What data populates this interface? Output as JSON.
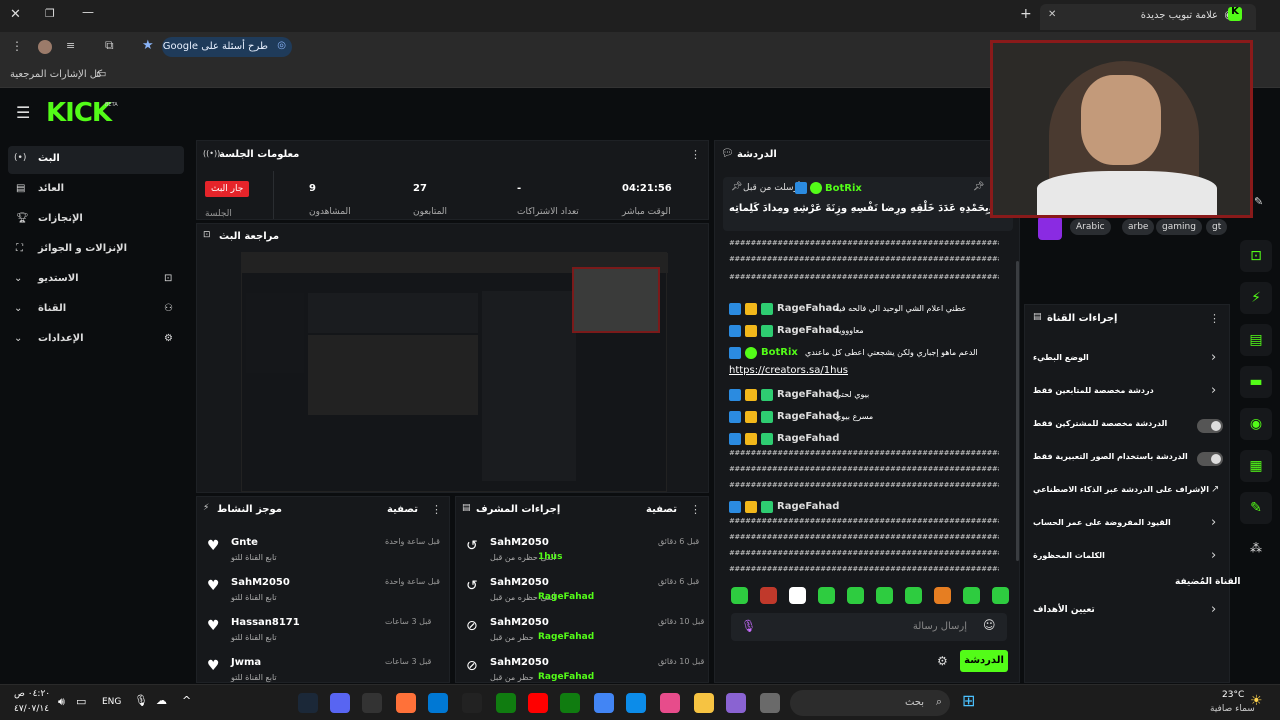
{
  "browser": {
    "tab_title": "علامة تبويب جديدة",
    "google_prompt": "طرح أسئلة على Google",
    "bookmarks_label": "كل الإشارات المرجعية"
  },
  "kick": {
    "logo": "KICK",
    "beta": "BETA"
  },
  "sidebar": {
    "items": [
      {
        "label": "البث",
        "icon": "broadcast-icon"
      },
      {
        "label": "العائد",
        "icon": "chart-icon"
      },
      {
        "label": "الإنجازات",
        "icon": "trophy-icon"
      },
      {
        "label": "الإنزالات و الجوائز",
        "icon": "gift-icon"
      },
      {
        "label": "الاستديو",
        "icon": "camera-icon"
      },
      {
        "label": "القناة",
        "icon": "users-icon"
      },
      {
        "label": "الإعدادات",
        "icon": "gear-icon"
      }
    ]
  },
  "session": {
    "title": "معلومات الجلسة",
    "live_badge": "جار البث",
    "session_label": "الجلسة",
    "stats": [
      {
        "value": "9",
        "label": "المشاهدون"
      },
      {
        "value": "27",
        "label": "المتابعون"
      },
      {
        "value": "-",
        "label": "تعداد الاشتراكات"
      },
      {
        "value": "04:21:56",
        "label": "الوقت مباشر"
      }
    ]
  },
  "preview": {
    "title": "مراجعة البث"
  },
  "activity": {
    "title": "موجز النشاط",
    "filter": "تصفية",
    "items": [
      {
        "name": "Gnte",
        "action": "تابع القناة للتو",
        "time": "قبل ساعة واحدة"
      },
      {
        "name": "SahM2050",
        "action": "تابع القناة للتو",
        "time": "قبل ساعة واحدة"
      },
      {
        "name": "Hassan8171",
        "action": "تابع القناة للتو",
        "time": "قبل 3 ساعات"
      },
      {
        "name": "Jwma",
        "action": "تابع القناة للتو",
        "time": "قبل 3 ساعات"
      }
    ]
  },
  "mod": {
    "title": "إجراءات المشرف",
    "filter": "تصفية",
    "items": [
      {
        "name": "SahM2050",
        "action": "ألغى حظره من قبل",
        "by": "1hus",
        "time": "قبل 6 دقائق"
      },
      {
        "name": "SahM2050",
        "action": "ألغى حظره من قبل",
        "by": "RageFahad",
        "time": "قبل 6 دقائق"
      },
      {
        "name": "SahM2050",
        "action": "حظر من قبل",
        "by": "RageFahad",
        "time": "قبل 10 دقائق"
      },
      {
        "name": "SahM2050",
        "action": "حظر من قبل",
        "by": "RageFahad",
        "time": "قبل 10 دقائق"
      }
    ]
  },
  "chat": {
    "title": "الدردشة",
    "pinned_by": "أرسلت من قبل",
    "pinned_user": "BotRix",
    "pinned_text": "سُبحانَ اللهِ وبِحَمْدِهِ عَدَدَ خَلْقِهِ ورِضا نَفْسِهِ وزِنَةَ عَرْشِهِ ومِدادَ كَلِماتِه",
    "messages": [
      {
        "user": "RageFahad",
        "text": "عطني اعلام الشي الوحيد الي فالحه فيه"
      },
      {
        "user": "RageFahad",
        "text": "معاوووية"
      },
      {
        "user": "BotRix",
        "text": "الدعم ماهو إجباري ولكن يشجعني اعطى كل ماعندي",
        "link": "https://creators.sa/1hus"
      },
      {
        "user": "RageFahad",
        "text": "بيوي لحتي"
      },
      {
        "user": "RageFahad",
        "text": "مسرع بيوي"
      },
      {
        "user": "RageFahad",
        "text": ""
      },
      {
        "user": "RageFahad",
        "text": ""
      }
    ],
    "hash_line": "####################################################################################",
    "input_placeholder": "إرسال رسالة",
    "send_button": "الدردشة"
  },
  "channel_actions": {
    "title": "إجراءات القناة",
    "items": [
      {
        "label": "الوضع البطيء",
        "control": "chevron"
      },
      {
        "label": "دردشة مخصصة للمتابعين فقط",
        "control": "chevron"
      },
      {
        "label": "الدردشة مخصصة للمشتركين فقط",
        "control": "toggle"
      },
      {
        "label": "الدردشة باستخدام الصور التعبيرية فقط",
        "control": "toggle"
      },
      {
        "label": "الإشراف على الدردشة عبر الذكاء الاصطناعي",
        "control": "external"
      },
      {
        "label": "القيود المفروضة على عمر الحساب",
        "control": "chevron"
      },
      {
        "label": "الكلمات المحظورة",
        "control": "chevron"
      }
    ],
    "section2": "القناة المُضيفة",
    "target": "تعيين الأهداف"
  },
  "tags": [
    "Arabic",
    "arbe",
    "gaming",
    "gt"
  ],
  "taskbar": {
    "search": "بحث",
    "weather_temp": "23°C",
    "weather_desc": "سماء صافية",
    "lang": "ENG",
    "time": "٠٤:٢٠ ص",
    "date": "٤٧/٠٧/١٤"
  }
}
